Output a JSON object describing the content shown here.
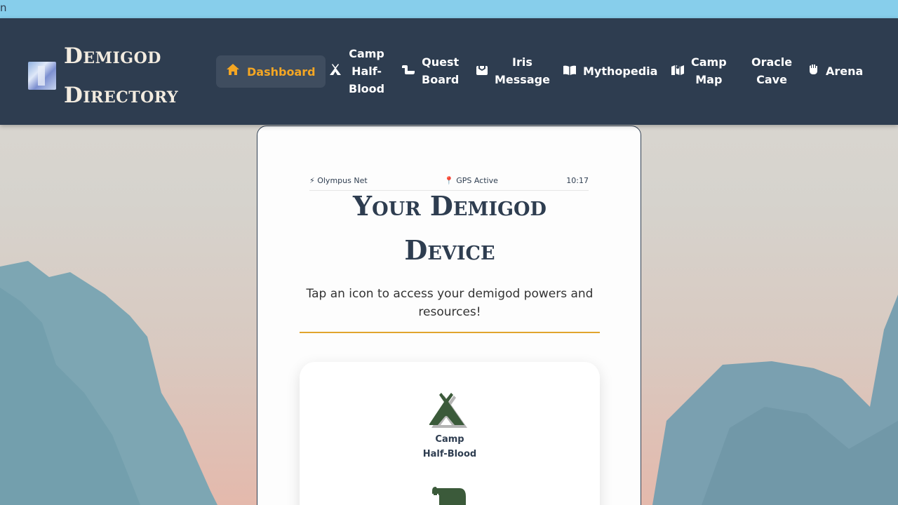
{
  "top_strip": {
    "text": "n"
  },
  "brand": {
    "line1": "Demigod",
    "line2": "Directory"
  },
  "nav": [
    {
      "icon": "home-icon",
      "label": "Dashboard",
      "active": true
    },
    {
      "icon": "tent-icon",
      "label_lines": [
        "Camp",
        "Half-",
        "Blood"
      ]
    },
    {
      "icon": "scroll-icon",
      "label_lines": [
        "Quest",
        "Board"
      ]
    },
    {
      "icon": "envelope-icon",
      "label_lines": [
        "Iris",
        "Message"
      ]
    },
    {
      "icon": "book-icon",
      "label": "Mythopedia"
    },
    {
      "icon": "map-icon",
      "label_lines": [
        "Camp",
        "Map"
      ]
    },
    {
      "label_lines": [
        "Oracle",
        "Cave"
      ]
    },
    {
      "icon": "fist-icon",
      "label": "Arena"
    }
  ],
  "device": {
    "status": {
      "network": "⚡ Olympus Net",
      "gps": "📍 GPS Active",
      "time": "10:17"
    },
    "title_line1": "Your Demigod",
    "title_line2": "Device",
    "subtitle": "Tap an icon to access your demigod powers and resources!",
    "apps": [
      {
        "icon": "tent-icon",
        "label_lines": [
          "Camp",
          "Half-Blood"
        ]
      },
      {
        "icon": "scroll-icon",
        "label_lines": []
      }
    ]
  },
  "colors": {
    "nav_bg": "#2e3d50",
    "accent": "#f4a623",
    "divider": "#e1a52d",
    "icon_green": "#3b5a3a"
  }
}
